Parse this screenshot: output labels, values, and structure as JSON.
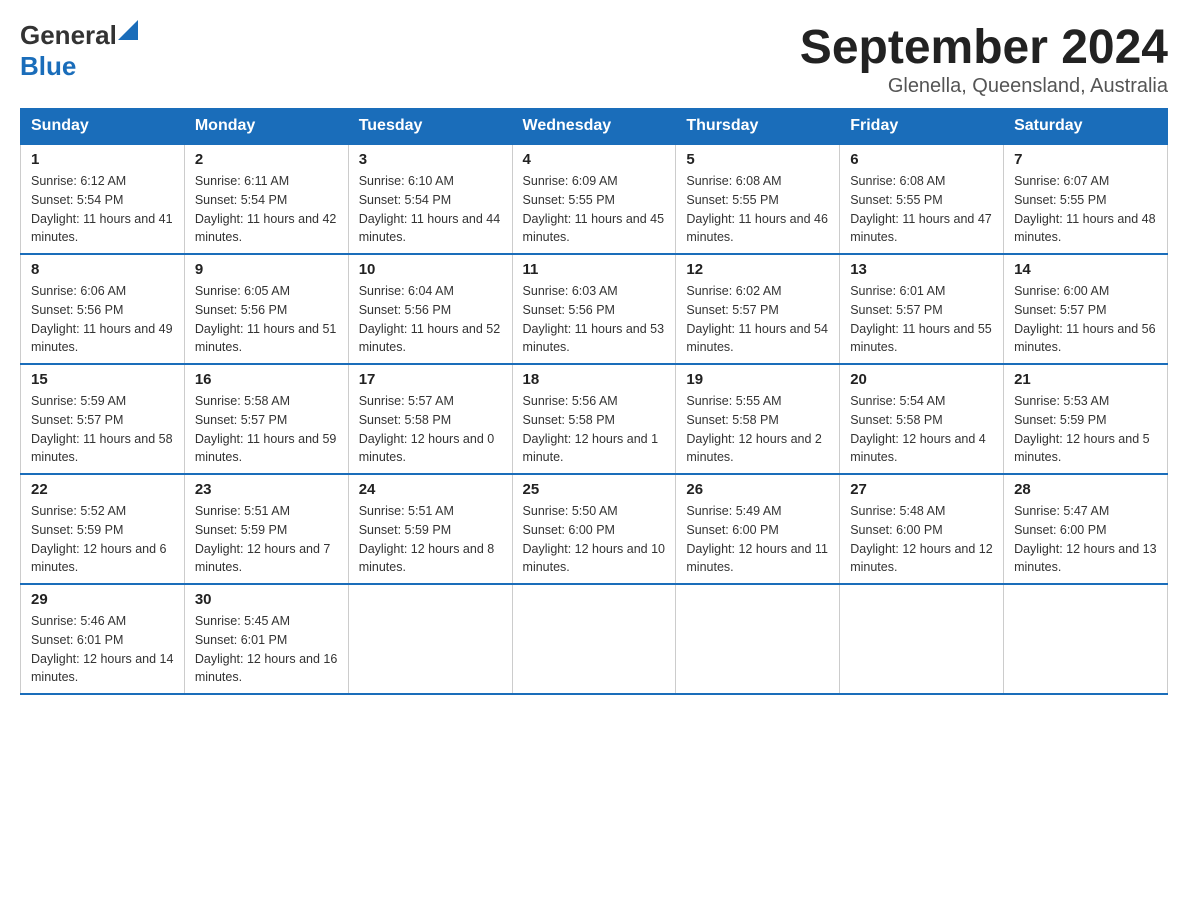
{
  "logo": {
    "general": "General",
    "blue": "Blue"
  },
  "title": "September 2024",
  "location": "Glenella, Queensland, Australia",
  "days_of_week": [
    "Sunday",
    "Monday",
    "Tuesday",
    "Wednesday",
    "Thursday",
    "Friday",
    "Saturday"
  ],
  "weeks": [
    [
      {
        "day": "1",
        "sunrise": "6:12 AM",
        "sunset": "5:54 PM",
        "daylight": "11 hours and 41 minutes."
      },
      {
        "day": "2",
        "sunrise": "6:11 AM",
        "sunset": "5:54 PM",
        "daylight": "11 hours and 42 minutes."
      },
      {
        "day": "3",
        "sunrise": "6:10 AM",
        "sunset": "5:54 PM",
        "daylight": "11 hours and 44 minutes."
      },
      {
        "day": "4",
        "sunrise": "6:09 AM",
        "sunset": "5:55 PM",
        "daylight": "11 hours and 45 minutes."
      },
      {
        "day": "5",
        "sunrise": "6:08 AM",
        "sunset": "5:55 PM",
        "daylight": "11 hours and 46 minutes."
      },
      {
        "day": "6",
        "sunrise": "6:08 AM",
        "sunset": "5:55 PM",
        "daylight": "11 hours and 47 minutes."
      },
      {
        "day": "7",
        "sunrise": "6:07 AM",
        "sunset": "5:55 PM",
        "daylight": "11 hours and 48 minutes."
      }
    ],
    [
      {
        "day": "8",
        "sunrise": "6:06 AM",
        "sunset": "5:56 PM",
        "daylight": "11 hours and 49 minutes."
      },
      {
        "day": "9",
        "sunrise": "6:05 AM",
        "sunset": "5:56 PM",
        "daylight": "11 hours and 51 minutes."
      },
      {
        "day": "10",
        "sunrise": "6:04 AM",
        "sunset": "5:56 PM",
        "daylight": "11 hours and 52 minutes."
      },
      {
        "day": "11",
        "sunrise": "6:03 AM",
        "sunset": "5:56 PM",
        "daylight": "11 hours and 53 minutes."
      },
      {
        "day": "12",
        "sunrise": "6:02 AM",
        "sunset": "5:57 PM",
        "daylight": "11 hours and 54 minutes."
      },
      {
        "day": "13",
        "sunrise": "6:01 AM",
        "sunset": "5:57 PM",
        "daylight": "11 hours and 55 minutes."
      },
      {
        "day": "14",
        "sunrise": "6:00 AM",
        "sunset": "5:57 PM",
        "daylight": "11 hours and 56 minutes."
      }
    ],
    [
      {
        "day": "15",
        "sunrise": "5:59 AM",
        "sunset": "5:57 PM",
        "daylight": "11 hours and 58 minutes."
      },
      {
        "day": "16",
        "sunrise": "5:58 AM",
        "sunset": "5:57 PM",
        "daylight": "11 hours and 59 minutes."
      },
      {
        "day": "17",
        "sunrise": "5:57 AM",
        "sunset": "5:58 PM",
        "daylight": "12 hours and 0 minutes."
      },
      {
        "day": "18",
        "sunrise": "5:56 AM",
        "sunset": "5:58 PM",
        "daylight": "12 hours and 1 minute."
      },
      {
        "day": "19",
        "sunrise": "5:55 AM",
        "sunset": "5:58 PM",
        "daylight": "12 hours and 2 minutes."
      },
      {
        "day": "20",
        "sunrise": "5:54 AM",
        "sunset": "5:58 PM",
        "daylight": "12 hours and 4 minutes."
      },
      {
        "day": "21",
        "sunrise": "5:53 AM",
        "sunset": "5:59 PM",
        "daylight": "12 hours and 5 minutes."
      }
    ],
    [
      {
        "day": "22",
        "sunrise": "5:52 AM",
        "sunset": "5:59 PM",
        "daylight": "12 hours and 6 minutes."
      },
      {
        "day": "23",
        "sunrise": "5:51 AM",
        "sunset": "5:59 PM",
        "daylight": "12 hours and 7 minutes."
      },
      {
        "day": "24",
        "sunrise": "5:51 AM",
        "sunset": "5:59 PM",
        "daylight": "12 hours and 8 minutes."
      },
      {
        "day": "25",
        "sunrise": "5:50 AM",
        "sunset": "6:00 PM",
        "daylight": "12 hours and 10 minutes."
      },
      {
        "day": "26",
        "sunrise": "5:49 AM",
        "sunset": "6:00 PM",
        "daylight": "12 hours and 11 minutes."
      },
      {
        "day": "27",
        "sunrise": "5:48 AM",
        "sunset": "6:00 PM",
        "daylight": "12 hours and 12 minutes."
      },
      {
        "day": "28",
        "sunrise": "5:47 AM",
        "sunset": "6:00 PM",
        "daylight": "12 hours and 13 minutes."
      }
    ],
    [
      {
        "day": "29",
        "sunrise": "5:46 AM",
        "sunset": "6:01 PM",
        "daylight": "12 hours and 14 minutes."
      },
      {
        "day": "30",
        "sunrise": "5:45 AM",
        "sunset": "6:01 PM",
        "daylight": "12 hours and 16 minutes."
      },
      null,
      null,
      null,
      null,
      null
    ]
  ]
}
